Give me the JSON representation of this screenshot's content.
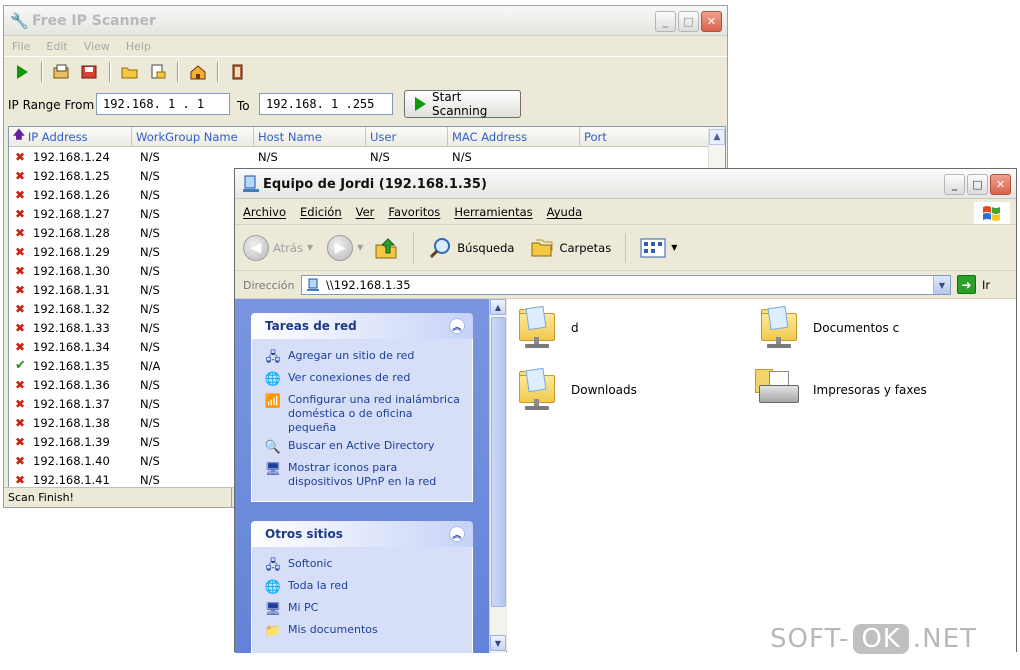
{
  "scanner": {
    "title": "Free IP Scanner",
    "menu": [
      "File",
      "Edit",
      "View",
      "Help"
    ],
    "range_from_label": "IP Range From",
    "range_from_value": "192.168. 1 . 1",
    "range_to_label": "To",
    "range_to_value": "192.168. 1 .255",
    "start_button": "Start Scanning",
    "columns": [
      "IP Address",
      "WorkGroup Name",
      "Host Name",
      "User",
      "MAC Address",
      "Port"
    ],
    "rows": [
      {
        "ip": "192.168.1.24",
        "status": "fail",
        "workgroup": "N/S",
        "host": "N/S",
        "user": "N/S",
        "mac": "N/S"
      },
      {
        "ip": "192.168.1.25",
        "status": "fail",
        "workgroup": "N/S",
        "host": "",
        "user": "",
        "mac": ""
      },
      {
        "ip": "192.168.1.26",
        "status": "fail",
        "workgroup": "N/S",
        "host": "",
        "user": "",
        "mac": ""
      },
      {
        "ip": "192.168.1.27",
        "status": "fail",
        "workgroup": "N/S",
        "host": "",
        "user": "",
        "mac": ""
      },
      {
        "ip": "192.168.1.28",
        "status": "fail",
        "workgroup": "N/S",
        "host": "",
        "user": "",
        "mac": ""
      },
      {
        "ip": "192.168.1.29",
        "status": "fail",
        "workgroup": "N/S",
        "host": "",
        "user": "",
        "mac": ""
      },
      {
        "ip": "192.168.1.30",
        "status": "fail",
        "workgroup": "N/S",
        "host": "",
        "user": "",
        "mac": ""
      },
      {
        "ip": "192.168.1.31",
        "status": "fail",
        "workgroup": "N/S",
        "host": "",
        "user": "",
        "mac": ""
      },
      {
        "ip": "192.168.1.32",
        "status": "fail",
        "workgroup": "N/S",
        "host": "",
        "user": "",
        "mac": ""
      },
      {
        "ip": "192.168.1.33",
        "status": "fail",
        "workgroup": "N/S",
        "host": "",
        "user": "",
        "mac": ""
      },
      {
        "ip": "192.168.1.34",
        "status": "fail",
        "workgroup": "N/S",
        "host": "",
        "user": "",
        "mac": ""
      },
      {
        "ip": "192.168.1.35",
        "status": "ok",
        "workgroup": "N/A",
        "host": "",
        "user": "",
        "mac": ""
      },
      {
        "ip": "192.168.1.36",
        "status": "fail",
        "workgroup": "N/S",
        "host": "",
        "user": "",
        "mac": ""
      },
      {
        "ip": "192.168.1.37",
        "status": "fail",
        "workgroup": "N/S",
        "host": "",
        "user": "",
        "mac": ""
      },
      {
        "ip": "192.168.1.38",
        "status": "fail",
        "workgroup": "N/S",
        "host": "",
        "user": "",
        "mac": ""
      },
      {
        "ip": "192.168.1.39",
        "status": "fail",
        "workgroup": "N/S",
        "host": "",
        "user": "",
        "mac": ""
      },
      {
        "ip": "192.168.1.40",
        "status": "fail",
        "workgroup": "N/S",
        "host": "",
        "user": "",
        "mac": ""
      },
      {
        "ip": "192.168.1.41",
        "status": "fail",
        "workgroup": "N/S",
        "host": "",
        "user": "",
        "mac": ""
      }
    ],
    "status": "Scan Finish!",
    "toolbar_icons": [
      "play-icon",
      "open-icon",
      "save-icon",
      "folder-icon",
      "export-icon",
      "home-icon",
      "exit-icon"
    ]
  },
  "explorer": {
    "title": "Equipo de Jordi (192.168.1.35)",
    "menu": [
      "Archivo",
      "Edición",
      "Ver",
      "Favoritos",
      "Herramientas",
      "Ayuda"
    ],
    "toolbar": {
      "back": "Atrás",
      "search": "Búsqueda",
      "folders": "Carpetas"
    },
    "address_label": "Dirección",
    "address_value": "\\\\192.168.1.35",
    "go_label": "Ir",
    "tasks_title": "Tareas de red",
    "tasks": [
      {
        "icon": "add-network-place-icon",
        "label": "Agregar un sitio de red"
      },
      {
        "icon": "network-connections-icon",
        "label": "Ver conexiones de red"
      },
      {
        "icon": "wireless-network-icon",
        "label": "Configurar una red inalámbrica doméstica o de oficina pequeña"
      },
      {
        "icon": "active-directory-icon",
        "label": "Buscar en Active Directory"
      },
      {
        "icon": "upnp-icon",
        "label": "Mostrar iconos para dispositivos UPnP en la red"
      }
    ],
    "other_title": "Otros sitios",
    "other_places": [
      {
        "icon": "network-computer-icon",
        "label": "Softonic"
      },
      {
        "icon": "entire-network-icon",
        "label": "Toda la red"
      },
      {
        "icon": "my-computer-icon",
        "label": "Mi PC"
      },
      {
        "icon": "my-documents-icon",
        "label": "Mis documentos"
      }
    ],
    "items": [
      {
        "label": "d",
        "kind": "share"
      },
      {
        "label": "Documentos c",
        "kind": "share"
      },
      {
        "label": "Downloads",
        "kind": "share"
      },
      {
        "label": "Impresoras y faxes",
        "kind": "printer"
      }
    ]
  },
  "watermark": {
    "left": "SOFT-",
    "middle": "OK",
    "right": ".NET"
  },
  "colors": {
    "taskpane": "#6283d8",
    "task_link": "#1d3f9b",
    "header_text": "#3060c8",
    "fail": "#d02010",
    "ok": "#209020"
  }
}
